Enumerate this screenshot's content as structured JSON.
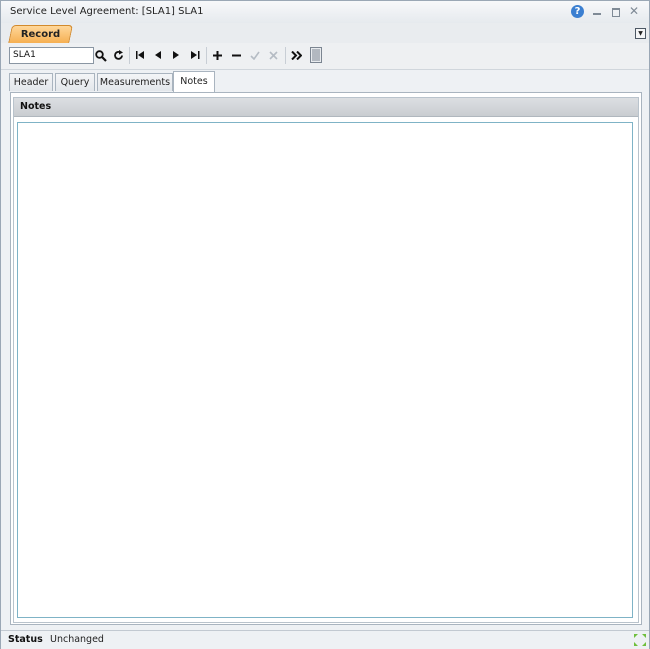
{
  "window": {
    "title": "Service Level Agreement: [SLA1] SLA1"
  },
  "icons": {
    "help": "help-icon",
    "minimize": "minimize-icon",
    "maximize": "maximize-icon",
    "close": "close-icon",
    "search": "search-icon",
    "refresh": "refresh-icon",
    "first": "first-record-icon",
    "previous": "previous-record-icon",
    "next": "next-record-icon",
    "last": "last-record-icon",
    "add": "add-icon",
    "remove": "remove-icon",
    "accept": "check-icon",
    "cancel": "cancel-icon",
    "more": "double-chevron-icon",
    "document": "document-icon"
  },
  "tabs": {
    "record": "Record"
  },
  "toolbar": {
    "record_value": "SLA1"
  },
  "subtabs": [
    {
      "label": "Header"
    },
    {
      "label": "Query"
    },
    {
      "label": "Measurements"
    },
    {
      "label": "Notes"
    }
  ],
  "panel": {
    "title": "Notes",
    "content": ""
  },
  "status": {
    "label": "Status",
    "value": "Unchanged"
  },
  "colors": {
    "accent": "#f5ad4e",
    "help": "#3b7fd1",
    "notes_border": "#7fb3c6"
  }
}
